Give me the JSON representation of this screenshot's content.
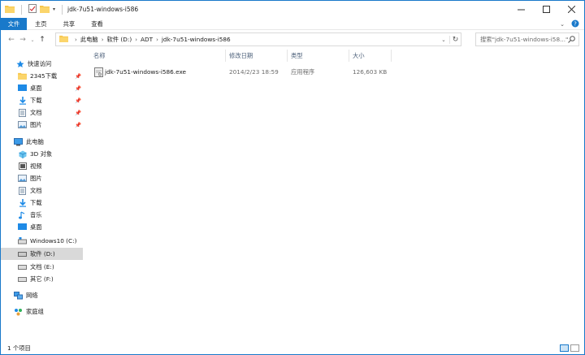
{
  "window": {
    "title": "jdk-7u51-windows-i586"
  },
  "ribbon": {
    "tabs": [
      "文件",
      "主页",
      "共享",
      "查看"
    ]
  },
  "address": {
    "crumbs": [
      "此电脑",
      "软件 (D:)",
      "ADT",
      "jdk-7u51-windows-i586"
    ],
    "search_placeholder": "搜索\"jdk-7u51-windows-i58...\""
  },
  "nav": {
    "quick_access": "快速访问",
    "quick_items": [
      "2345下载",
      "桌面",
      "下载",
      "文档",
      "图片"
    ],
    "this_pc": "此电脑",
    "pc_items": [
      "3D 对象",
      "视频",
      "图片",
      "文档",
      "下载",
      "音乐",
      "桌面",
      "Windows10 (C:)",
      "软件 (D:)",
      "文档 (E:)",
      "其它 (F:)"
    ],
    "network": "网络",
    "homegroup": "家庭组"
  },
  "list": {
    "headers": [
      "名称",
      "修改日期",
      "类型",
      "大小"
    ],
    "rows": [
      {
        "name": "jdk-7u51-windows-i586.exe",
        "modified": "2014/2/23 18:59",
        "type": "应用程序",
        "size": "126,603 KB"
      }
    ]
  },
  "status": {
    "count": "1 个项目"
  },
  "colors": {
    "accent": "#1979ca",
    "selected_nav": "#d9d9d9"
  }
}
